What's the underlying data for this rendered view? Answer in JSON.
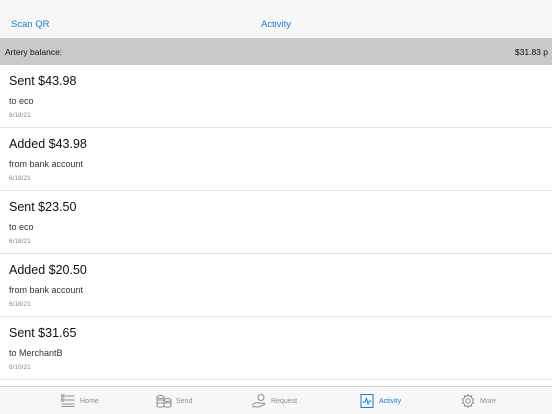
{
  "header": {
    "scan_qr": "Scan QR",
    "title": "Activity"
  },
  "balance": {
    "label": "Artery balance:",
    "value": "$31.83 p"
  },
  "transactions": [
    {
      "title": "Sent $43.98",
      "subtitle": "to eco",
      "date": "6/18/21"
    },
    {
      "title": "Added $43.98",
      "subtitle": "from bank account",
      "date": "6/18/21"
    },
    {
      "title": "Sent $23.50",
      "subtitle": "to eco",
      "date": "6/18/21"
    },
    {
      "title": "Added $20.50",
      "subtitle": "from bank account",
      "date": "6/18/21"
    },
    {
      "title": "Sent $31.65",
      "subtitle": "to MerchantB",
      "date": "6/10/21"
    }
  ],
  "tabs": [
    {
      "label": "Home",
      "icon": "home-list-icon",
      "active": false
    },
    {
      "label": "Send",
      "icon": "coins-icon",
      "active": false
    },
    {
      "label": "Request",
      "icon": "hand-coin-icon",
      "active": false
    },
    {
      "label": "Activity",
      "icon": "activity-chart-icon",
      "active": true
    },
    {
      "label": "More",
      "icon": "gear-icon",
      "active": false
    }
  ],
  "colors": {
    "accent": "#1e7ad8",
    "balance_bar": "#c9c9c9",
    "inactive_tab": "#8e8e93"
  }
}
